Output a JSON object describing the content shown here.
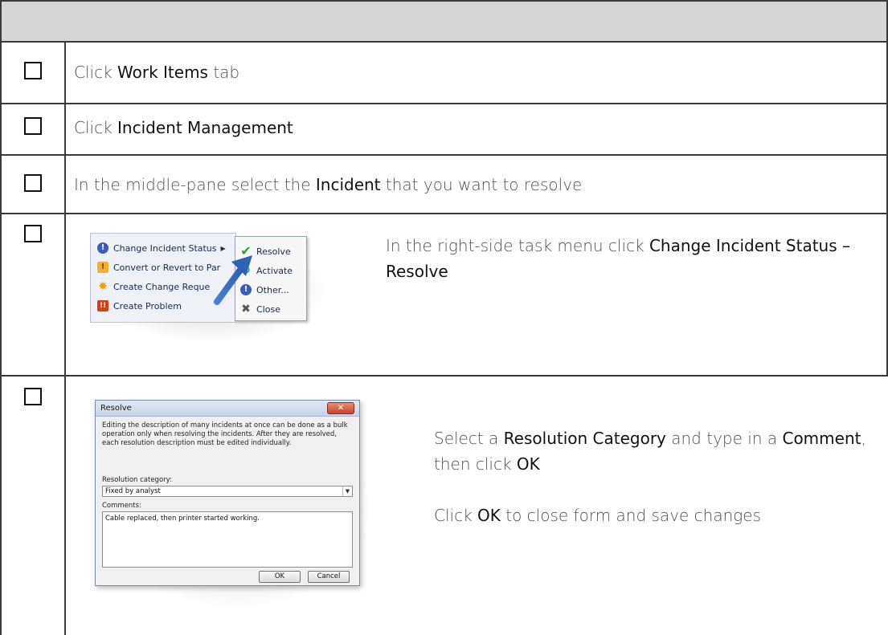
{
  "steps": [
    {
      "pre": "Click ",
      "bold": "Work Items",
      "post": " tab"
    },
    {
      "pre": "Click ",
      "bold": "Incident Management",
      "post": ""
    },
    {
      "pre": "In the middle-pane select the ",
      "bold": "Incident",
      "post": " that you want to resolve"
    },
    {
      "pre": "In the right-side task menu click ",
      "bold": "Change Incident Status – Resolve",
      "post": ""
    },
    {
      "pre": "Select a ",
      "bold": "Resolution Category",
      "mid": " and type in a ",
      "bold2": "Comment",
      "post": ", then click ",
      "bold3": "OK",
      "line2_pre": "Click ",
      "line2_bold": "OK",
      "line2_post": " to close form and save changes"
    }
  ],
  "context_menu": {
    "left_items": [
      {
        "label": "Change Incident Status",
        "icon": "info-icon"
      },
      {
        "label": "Convert or Revert to Par",
        "icon": "warning-icon"
      },
      {
        "label": "Create Change Reque",
        "icon": "change-request-icon"
      },
      {
        "label": "Create Problem",
        "icon": "problem-icon"
      }
    ],
    "submenu_items": [
      {
        "label": "Resolve",
        "icon": "check-icon"
      },
      {
        "label": "Activate",
        "icon": "refresh-icon"
      },
      {
        "label": "Other...",
        "icon": "info-icon"
      },
      {
        "label": "Close",
        "icon": "x-icon"
      }
    ]
  },
  "dialog": {
    "title": "Resolve",
    "description": "Editing the description of many incidents at once can be done as a bulk operation only when resolving the incidents. After they are resolved, each resolution description must be edited individually.",
    "resolution_label": "Resolution category:",
    "resolution_value": "Fixed by analyst",
    "comments_label": "Comments:",
    "comments_value": "Cable replaced, then printer started working.",
    "ok_label": "OK",
    "cancel_label": "Cancel"
  }
}
